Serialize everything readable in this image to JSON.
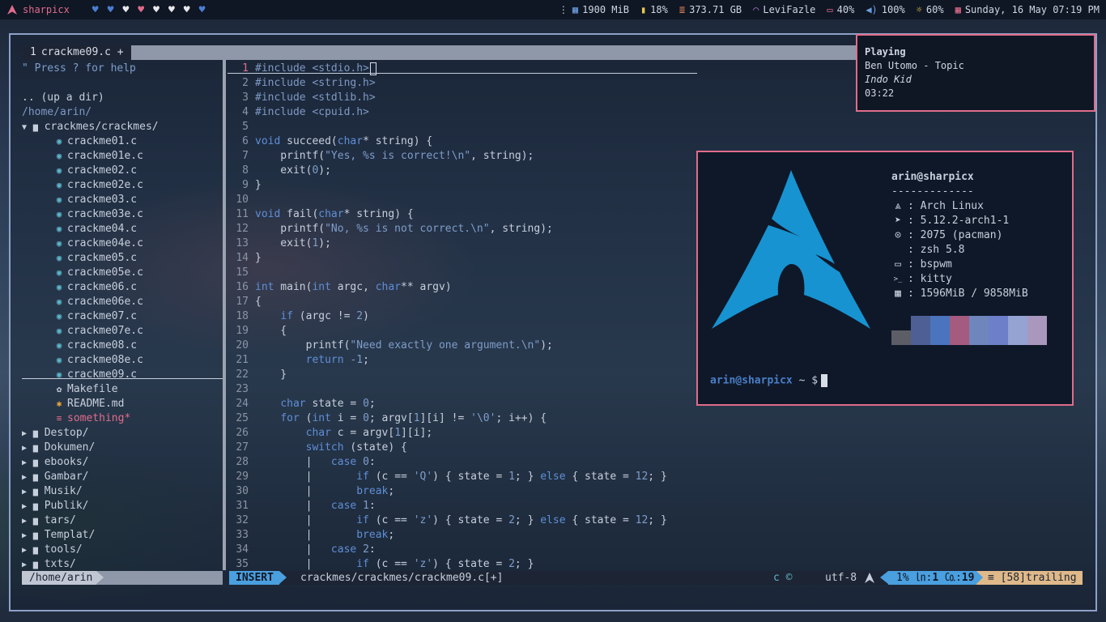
{
  "topbar": {
    "hostname": "sharpicx",
    "hearts": [
      "#4a7fd0",
      "#4a7fd0",
      "#e8e8ec",
      "#e06c8a",
      "#e8e8ec",
      "#e8e8ec",
      "#e8e8ec",
      "#4a7fd0"
    ],
    "ram": "1900 MiB",
    "battery": "18%",
    "disk": "373.71 GB",
    "wifi": "LeviFazle",
    "brightness_battery": "40%",
    "volume": "100%",
    "brightness": "60%",
    "datetime": "Sunday, 16 May 07:19 PM"
  },
  "vim": {
    "tab": {
      "number": "1",
      "name": "crackme09.c",
      "modified": "+"
    },
    "tree": {
      "help": "\" Press ? for help",
      "up_dir": ".. (up a dir)",
      "cwd": "/home/arin/",
      "open_dir": "crackmes/crackmes/",
      "files": [
        "crackme01.c",
        "crackme01e.c",
        "crackme02.c",
        "crackme02e.c",
        "crackme03.c",
        "crackme03e.c",
        "crackme04.c",
        "crackme04e.c",
        "crackme05.c",
        "crackme05e.c",
        "crackme06.c",
        "crackme06e.c",
        "crackme07.c",
        "crackme07e.c",
        "crackme08.c",
        "crackme08e.c",
        "crackme09.c"
      ],
      "other_files": [
        {
          "icon": "gear-icon",
          "name": "Makefile"
        },
        {
          "icon": "markdown-icon",
          "name": "README.md"
        },
        {
          "icon": "text-file-icon",
          "name": "something*"
        }
      ],
      "dirs": [
        "Destop/",
        "Dokumen/",
        "ebooks/",
        "Gambar/",
        "Musik/",
        "Publik/",
        "tars/",
        "Templat/",
        "tools/",
        "txts/"
      ]
    },
    "status_left": "/home/arin",
    "status": {
      "mode": "INSERT",
      "file": "crackmes/crackmes/crackme09.c[+]",
      "filetype": "c",
      "encoding": "utf-8",
      "percent": "1%",
      "line": "1",
      "col": "19",
      "warning": "[58]trailing"
    }
  },
  "notification": {
    "title": "Playing",
    "artist_track": "Ben Utomo - Topic",
    "album": "Indo Kid",
    "time": "03:22"
  },
  "fetch": {
    "user": "arin@sharpicx",
    "separator": "-------------",
    "rows": [
      {
        "icon": "arch-icon",
        "value": ": Arch Linux"
      },
      {
        "icon": "rocket-icon",
        "value": ": 5.12.2-arch1-1"
      },
      {
        "icon": "package-icon",
        "value": ": 2075 (pacman)"
      },
      {
        "icon": "code-icon",
        "value": ": zsh 5.8"
      },
      {
        "icon": "laptop-icon",
        "value": ": bspwm"
      },
      {
        "icon": "terminal-icon",
        "value": ": kitty"
      },
      {
        "icon": "grid-icon",
        "value": ": 1596MiB / 9858MiB"
      }
    ],
    "swatches": [
      "#5c5e66",
      "#4d5f95",
      "#4a74bd",
      "#a55a7f",
      "#6f86bd",
      "#6c7fc8",
      "#94a3d2",
      "#aa97bd"
    ],
    "prompt_user": "arin@sharpicx",
    "prompt_tail": " ~ $"
  },
  "colors": {
    "accent": "#4a9fdf",
    "border": "#e06c8a",
    "frame": "#8fa0c8"
  }
}
